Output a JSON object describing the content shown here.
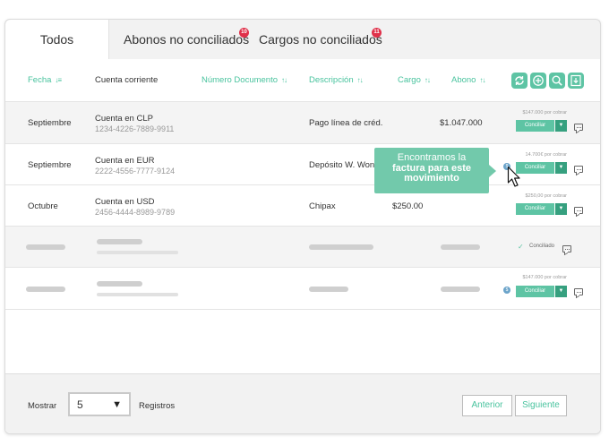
{
  "tabs": [
    {
      "label": "Todos"
    },
    {
      "label": "Abonos no conciliados",
      "badge": "10"
    },
    {
      "label": "Cargos no conciliados",
      "badge": "11"
    }
  ],
  "columns": {
    "fecha": "Fecha",
    "cuenta": "Cuenta corriente",
    "documento": "Número Documento",
    "descripcion": "Descripción",
    "cargo": "Cargo",
    "abono": "Abono"
  },
  "toolbar": [
    "refresh-icon",
    "add-icon",
    "search-icon",
    "download-icon"
  ],
  "rows": [
    {
      "fecha": "Septiembre",
      "cuenta": "Cuenta en CLP",
      "numero": "1234-4226-7889-9911",
      "descripcion": "Pago línea de créd.",
      "cargo": "",
      "abono": "$1.047.000",
      "cobrar": "$147.000 por cobrar",
      "conciliar": "Conciliar"
    },
    {
      "fecha": "Septiembre",
      "cuenta": "Cuenta en EUR",
      "numero": "2222-4556-7777-9124",
      "descripcion": "Depósito W. Won",
      "cargo": "",
      "abono": "",
      "cobrar": "14.700€ por cobrar",
      "conciliar": "Conciliar"
    },
    {
      "fecha": "Octubre",
      "cuenta": "Cuenta en USD",
      "numero": "2456-4444-8989-9789",
      "descripcion": "Chipax",
      "cargo": "$250.00",
      "abono": "",
      "cobrar": "$250,00 por cobrar",
      "conciliar": "Conciliar"
    }
  ],
  "placeholder_rows": [
    {
      "status": "Conciliado"
    },
    {
      "cobrar": "$147.000 por cobrar",
      "conciliar": "Conciliar"
    }
  ],
  "tooltip": {
    "line1": "Encontramos la",
    "line2": "factura para este",
    "line3": "movimiento"
  },
  "footer": {
    "mostrar": "Mostrar",
    "page_size": "5",
    "registros": "Registros",
    "anterior": "Anterior",
    "siguiente": "Siguiente"
  },
  "colors": {
    "accent": "#5ec4a4",
    "accent_dark": "#36a07f",
    "badge": "#e0314a",
    "info": "#6aa3c9"
  }
}
